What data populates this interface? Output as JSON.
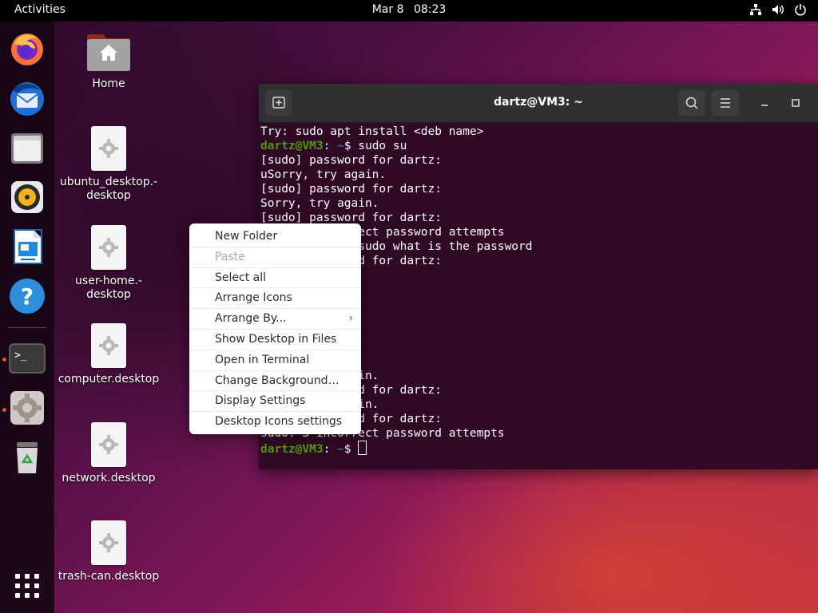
{
  "topbar": {
    "activities": "Activities",
    "date": "Mar 8",
    "time": "08:23",
    "tray_icons": [
      "network-icon",
      "volume-icon",
      "power-icon"
    ]
  },
  "dock": {
    "apps": [
      {
        "name": "firefox",
        "icon": "firefox-icon"
      },
      {
        "name": "thunderbird",
        "icon": "thunderbird-icon"
      },
      {
        "name": "files",
        "icon": "files-icon"
      },
      {
        "name": "rhythmbox",
        "icon": "rhythmbox-icon"
      },
      {
        "name": "libreoffice-writer",
        "icon": "writer-icon"
      },
      {
        "name": "help",
        "icon": "help-icon"
      },
      {
        "name": "terminal",
        "icon": "terminal-icon",
        "running": true
      },
      {
        "name": "settings",
        "icon": "settings-icon",
        "running": true
      },
      {
        "name": "trash",
        "icon": "trash-icon"
      }
    ],
    "show_apps_icon": "app-grid-icon"
  },
  "desktop": {
    "icons": [
      {
        "label": "Home"
      },
      {
        "label": "ubuntu_desktop.-\ndesktop"
      },
      {
        "label": "user-home.-\ndesktop"
      },
      {
        "label": "computer.desktop"
      },
      {
        "label": "network.desktop"
      },
      {
        "label": "trash-can.desktop"
      }
    ]
  },
  "terminal": {
    "title": "dartz@VM3: ~",
    "prompt_user": "dartz@VM3",
    "prompt_path": ":",
    "prompt_tail": " ~",
    "lines": [
      {
        "text": "Try: sudo apt install <deb name>"
      },
      {
        "user": "dartz@VM3",
        "sep": ":",
        "path": " ~",
        "cmd": "$ sudo su"
      },
      {
        "text": "[sudo] password for dartz:"
      },
      {
        "text": "uSorry, try again."
      },
      {
        "text": "[sudo] password for dartz:"
      },
      {
        "text": "Sorry, try again."
      },
      {
        "text": "[sudo] password for dartz:"
      },
      {
        "text": "sudo: 3 incorrect password attempts"
      },
      {
        "user": "dartz@VM3",
        "sep": ":",
        "path": " ~",
        "cmd": "$ sudo what is the password"
      },
      {
        "text": "[sudo] password for dartz:"
      },
      {
        "text": ""
      },
      {
        "text": ""
      },
      {
        "text": ""
      },
      {
        "text": ""
      },
      {
        "text": ""
      },
      {
        "text": ""
      },
      {
        "text": ""
      },
      {
        "text": "Sorry, try again."
      },
      {
        "text": "[sudo] password for dartz:"
      },
      {
        "text": "Sorry, try again."
      },
      {
        "text": "[sudo] password for dartz:"
      },
      {
        "text": "sudo: 3 incorrect password attempts"
      },
      {
        "user": "dartz@VM3",
        "sep": ":",
        "path": " ~",
        "cmd": "$ ",
        "cursor": true
      }
    ]
  },
  "context_menu": {
    "items": [
      {
        "label": "New Folder",
        "enabled": true
      },
      {
        "label": "Paste",
        "enabled": false
      },
      {
        "label": "Select all",
        "enabled": true
      },
      {
        "label": "Arrange Icons",
        "enabled": true
      },
      {
        "label": "Arrange By...",
        "enabled": true,
        "submenu": true
      },
      {
        "label": "Show Desktop in Files",
        "enabled": true
      },
      {
        "label": "Open in Terminal",
        "enabled": true
      },
      {
        "label": "Change Background…",
        "enabled": true
      },
      {
        "label": "Display Settings",
        "enabled": true
      },
      {
        "label": "Desktop Icons settings",
        "enabled": true
      }
    ]
  }
}
